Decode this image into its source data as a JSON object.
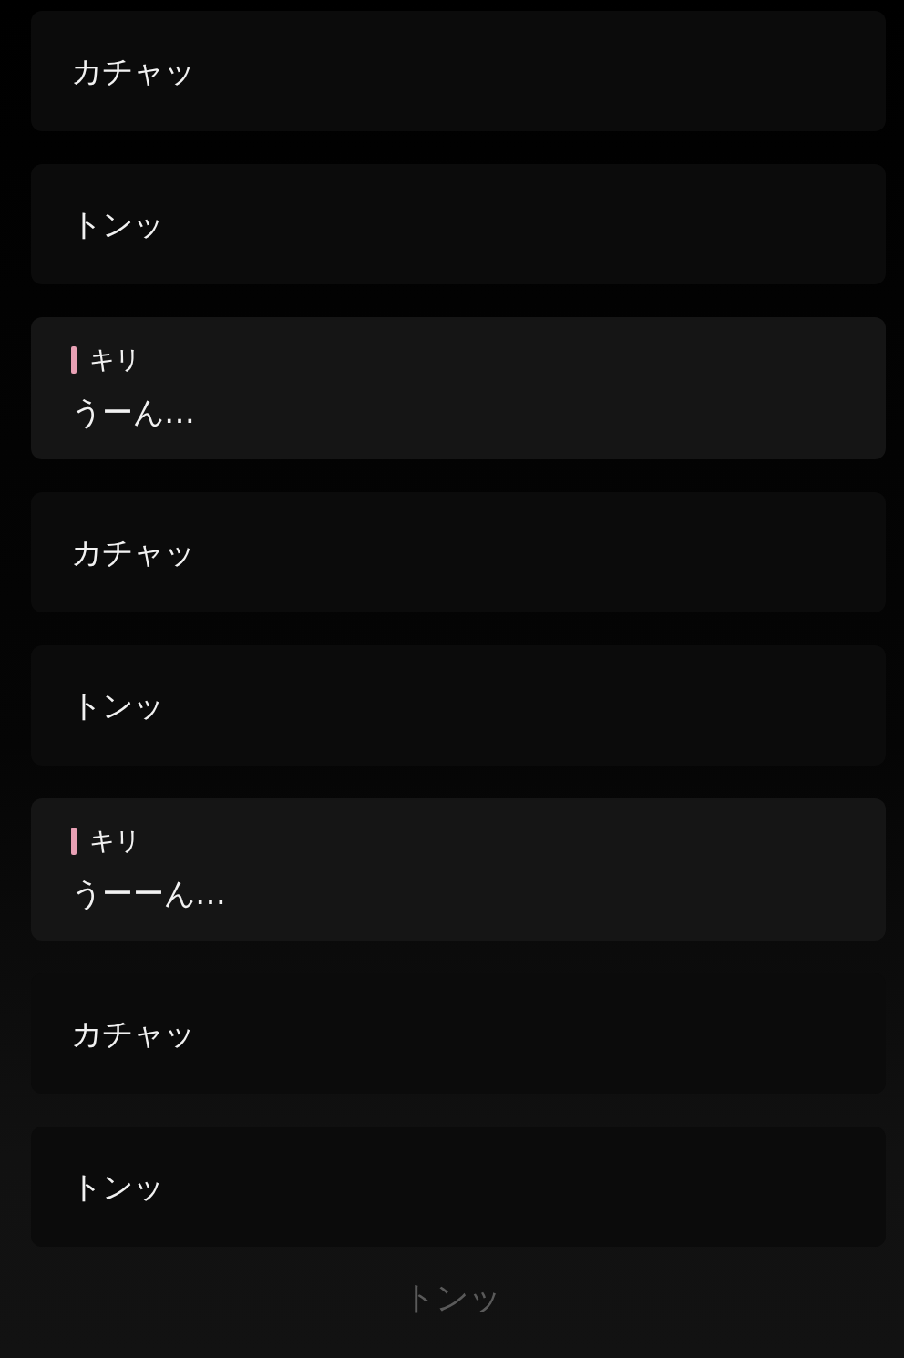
{
  "entries": [
    {
      "kind": "sfx",
      "text": "カチャッ"
    },
    {
      "kind": "sfx",
      "text": "トンッ"
    },
    {
      "kind": "dialogue",
      "speaker": "キリ",
      "color": "#e8a0b4",
      "text": "うーん…"
    },
    {
      "kind": "sfx",
      "text": "カチャッ"
    },
    {
      "kind": "sfx",
      "text": "トンッ"
    },
    {
      "kind": "dialogue",
      "speaker": "キリ",
      "color": "#e8a0b4",
      "text": "うーーん…"
    },
    {
      "kind": "sfx",
      "text": "カチャッ"
    },
    {
      "kind": "sfx",
      "text": "トンッ"
    }
  ],
  "caption": "トンッ"
}
